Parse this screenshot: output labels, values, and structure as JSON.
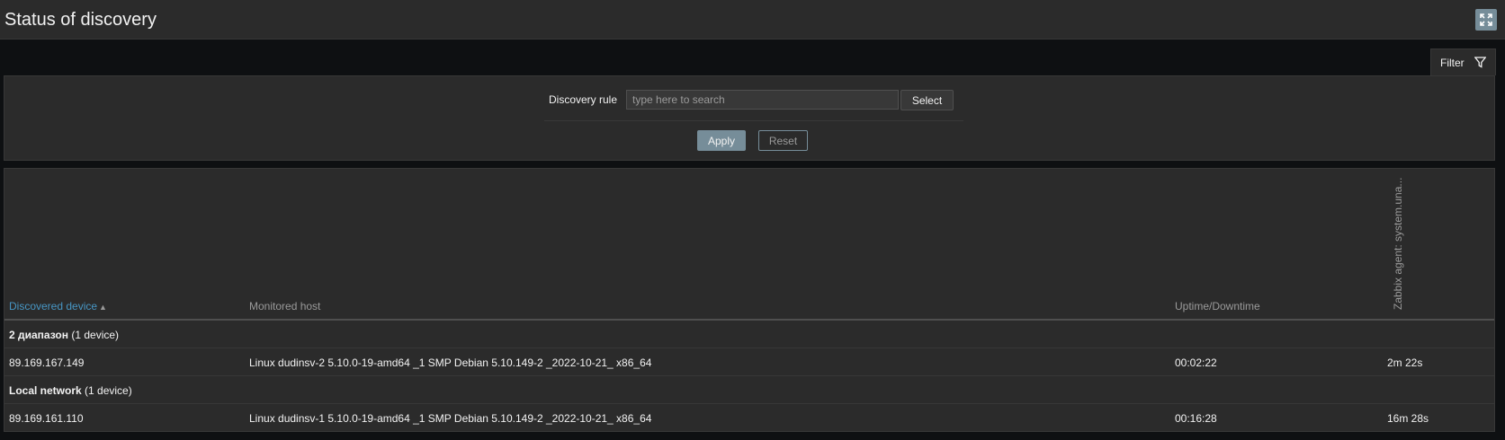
{
  "page": {
    "title": "Status of discovery"
  },
  "filter": {
    "tab_label": "Filter",
    "discovery_rule_label": "Discovery rule",
    "search_placeholder": "type here to search",
    "search_value": "",
    "select_label": "Select",
    "apply_label": "Apply",
    "reset_label": "Reset"
  },
  "table": {
    "columns": {
      "discovered_device": "Discovered device",
      "monitored_host": "Monitored host",
      "uptime": "Uptime/Downtime",
      "check": "Zabbix agent: system.una..."
    },
    "sort_indicator": "▲",
    "groups": [
      {
        "name": "2 диапазон",
        "count": "(1 device)",
        "devices": [
          {
            "ip": "89.169.167.149",
            "host": "Linux dudinsv-2 5.10.0-19-amd64 _1 SMP Debian 5.10.149-2 _2022-10-21_ x86_64",
            "uptime": "00:02:22",
            "check": "2m 22s"
          }
        ]
      },
      {
        "name": "Local network",
        "count": "(1 device)",
        "devices": [
          {
            "ip": "89.169.161.110",
            "host": "Linux dudinsv-1 5.10.0-19-amd64 _1 SMP Debian 5.10.149-2 _2022-10-21_ x86_64",
            "uptime": "00:16:28",
            "check": "16m 28s"
          }
        ]
      }
    ]
  },
  "colors": {
    "accent": "#768d99",
    "link": "#4796c4",
    "background": "#2b2b2b"
  }
}
